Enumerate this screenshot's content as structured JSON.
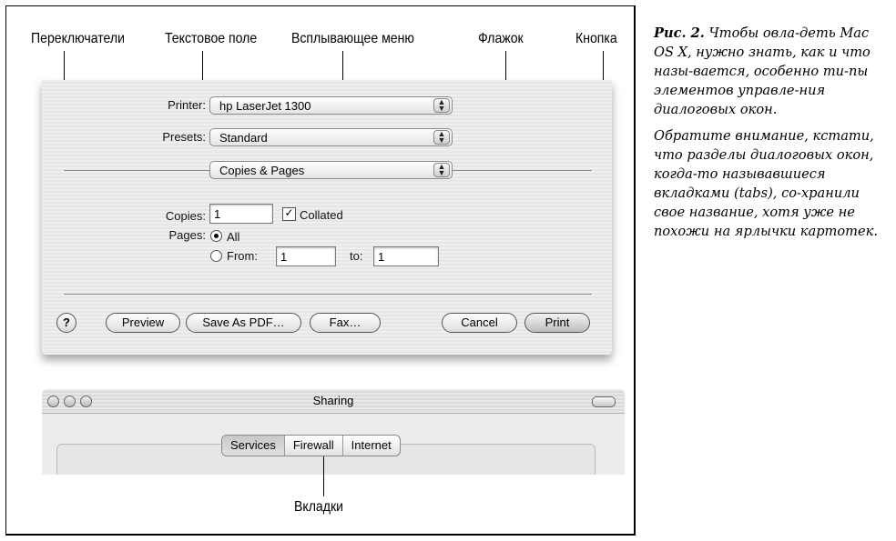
{
  "callouts": {
    "switches": "Переключатели",
    "text_field": "Текстовое поле",
    "popup_menu": "Всплывающее меню",
    "checkbox": "Флажок",
    "button": "Кнопка",
    "tabs": "Вкладки"
  },
  "print_dialog": {
    "printer_label": "Printer:",
    "printer_value": "hp LaserJet 1300",
    "presets_label": "Presets:",
    "presets_value": "Standard",
    "section_value": "Copies & Pages",
    "copies_label": "Copies:",
    "copies_value": "1",
    "collated_label": "Collated",
    "collated_checked": true,
    "pages_label": "Pages:",
    "pages_all": "All",
    "pages_from": "From:",
    "from_value": "1",
    "to_label": "to:",
    "to_value": "1",
    "help": "?",
    "preview": "Preview",
    "save_pdf": "Save As PDF…",
    "fax": "Fax…",
    "cancel": "Cancel",
    "print": "Print"
  },
  "sharing_window": {
    "title": "Sharing",
    "tabs": [
      "Services",
      "Firewall",
      "Internet"
    ],
    "selected_tab": "Services"
  },
  "caption": {
    "fig_label": "Рис. 2.",
    "p1": "Чтобы овла-деть Mac OS X, нужно знать, как и что назы-вается, особенно ти-пы элементов управле-ния диалоговых окон.",
    "p2": "Обратите внимание, кстати, что разделы диалоговых окон, когда-то называвшиеся вкладками (tabs), со-хранили свое название, хотя уже не похожи на ярлычки картотек."
  }
}
